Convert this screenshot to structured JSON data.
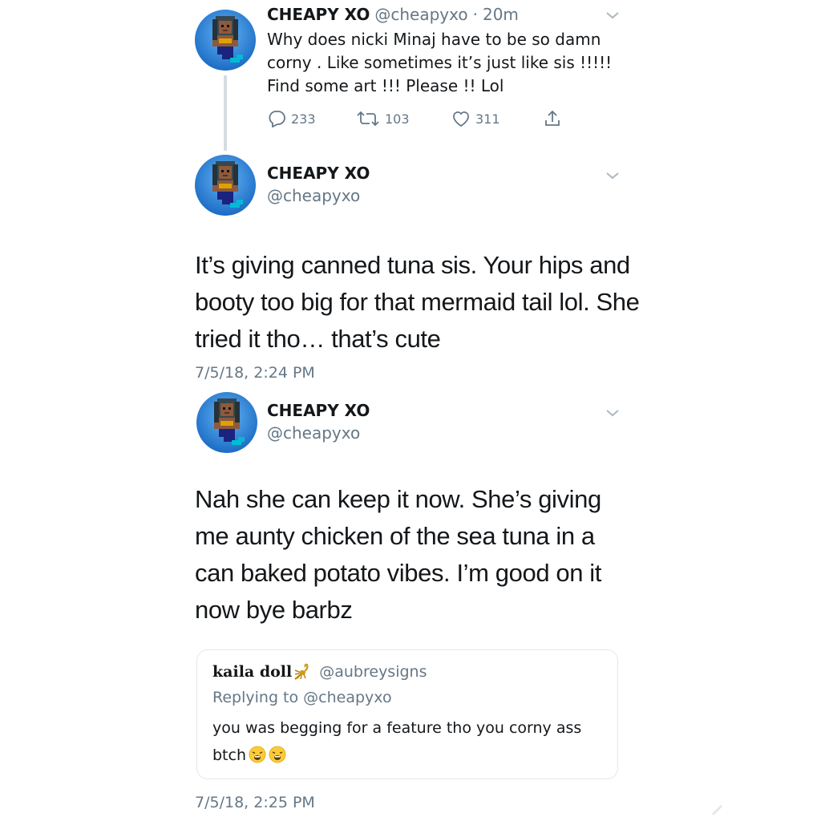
{
  "tweet1": {
    "name": "CHEAPY XO",
    "handle": "@cheapyxo",
    "separator": "·",
    "age": "20m",
    "text": "Why does nicki Minaj have to be so damn corny . Like sometimes it’s just like sis !!!!! Find some art !!! Please !! Lol",
    "reply_count": "233",
    "retweet_count": "103",
    "like_count": "311"
  },
  "tweet2": {
    "name": "CHEAPY XO",
    "handle": "@cheapyxo",
    "text": "It’s giving canned tuna sis. Your hips and booty too big for that mermaid tail lol. She tried it tho… that’s cute",
    "timestamp": "7/5/18, 2:24 PM"
  },
  "tweet3": {
    "name": "CHEAPY XO",
    "handle": "@cheapyxo",
    "text": "Nah she can keep it now. She’s giving me aunty chicken of the sea tuna in a can baked potato vibes. I’m good on it now bye barbz",
    "timestamp": "7/5/18, 2:25 PM",
    "quoted": {
      "name": "kaila doll",
      "name_emoji": "scorpion",
      "handle": "@aubreysigns",
      "replying_to": "Replying to @cheapyxo",
      "text": "you was begging for a feature tho you corny ass btch",
      "trailing_emoji": [
        "weary-face",
        "weary-face"
      ]
    }
  },
  "icons": {
    "reply": "reply-icon",
    "retweet": "retweet-icon",
    "like": "heart-icon",
    "share": "share-icon",
    "caret": "chevron-down-icon"
  },
  "colors": {
    "text": "#14171a",
    "secondary": "#657786",
    "avatar_bg": "#1e88e5",
    "thread_line": "#d5dce2"
  }
}
